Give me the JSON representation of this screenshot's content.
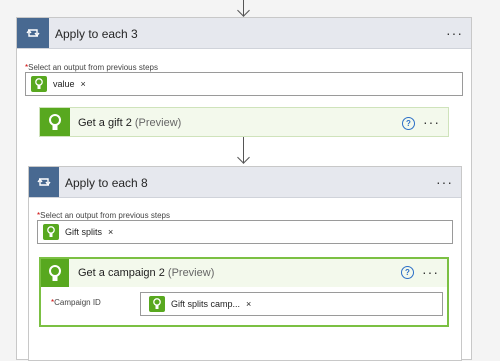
{
  "loop1": {
    "title": "Apply to each 3",
    "field_label": "Select an output from previous steps",
    "token": "value",
    "remove": "×",
    "more": "···"
  },
  "action1": {
    "title": "Get a gift 2",
    "preview": "(Preview)",
    "help": "?",
    "more": "···"
  },
  "loop2": {
    "title": "Apply to each 8",
    "field_label": "Select an output from previous steps",
    "token": "Gift splits",
    "remove": "×",
    "more": "···"
  },
  "action2": {
    "title": "Get a campaign 2",
    "preview": "(Preview)",
    "help": "?",
    "more": "···",
    "field_label": "Campaign ID",
    "token": "Gift splits camp...",
    "remove": "×"
  },
  "colors": {
    "loop_icon_bg": "#486991",
    "action_icon_bg": "#58a81f",
    "action_bg": "#f3f9ec"
  },
  "icons": {
    "loop": "loop-icon",
    "connector": "plug-icon",
    "help": "help-icon",
    "arrow": "arrow-down-icon"
  }
}
